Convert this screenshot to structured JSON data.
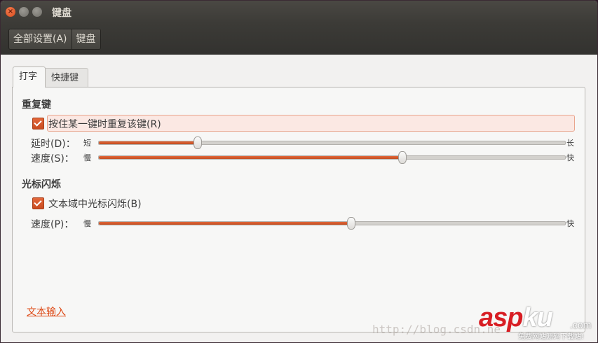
{
  "window": {
    "title": "键盘",
    "close_glyph": "×",
    "minimize_glyph": "–",
    "maximize_glyph": "□"
  },
  "toolbar": {
    "breadcrumbs": [
      "全部设置(A)",
      "键盘"
    ]
  },
  "tabs": [
    {
      "label": "打字",
      "active": true
    },
    {
      "label": "快捷键",
      "active": false
    }
  ],
  "repeat_keys": {
    "heading": "重复键",
    "checkbox_label": "按住某一键时重复该键(R)",
    "checked": true,
    "delay": {
      "label": "延时(D)：",
      "min_label": "短",
      "max_label": "长",
      "value": 0.21
    },
    "speed": {
      "label": "速度(S)：",
      "min_label": "慢",
      "max_label": "快",
      "value": 0.65
    }
  },
  "cursor_blink": {
    "heading": "光标闪烁",
    "checkbox_label": "文本域中光标闪烁(B)",
    "checked": true,
    "speed": {
      "label": "速度(P)：",
      "min_label": "慢",
      "max_label": "快",
      "value": 0.54
    }
  },
  "footer_link": "文本输入",
  "watermark": {
    "url": "http://blog.csdn.ne",
    "logo_asp": "asp",
    "logo_ku": "ku",
    "logo_com": ".com",
    "subtitle": "免费网站源码下载站!"
  },
  "colors": {
    "accent": "#dd4814",
    "titlebar": "#3c3b37",
    "background": "#f2f1f0"
  }
}
